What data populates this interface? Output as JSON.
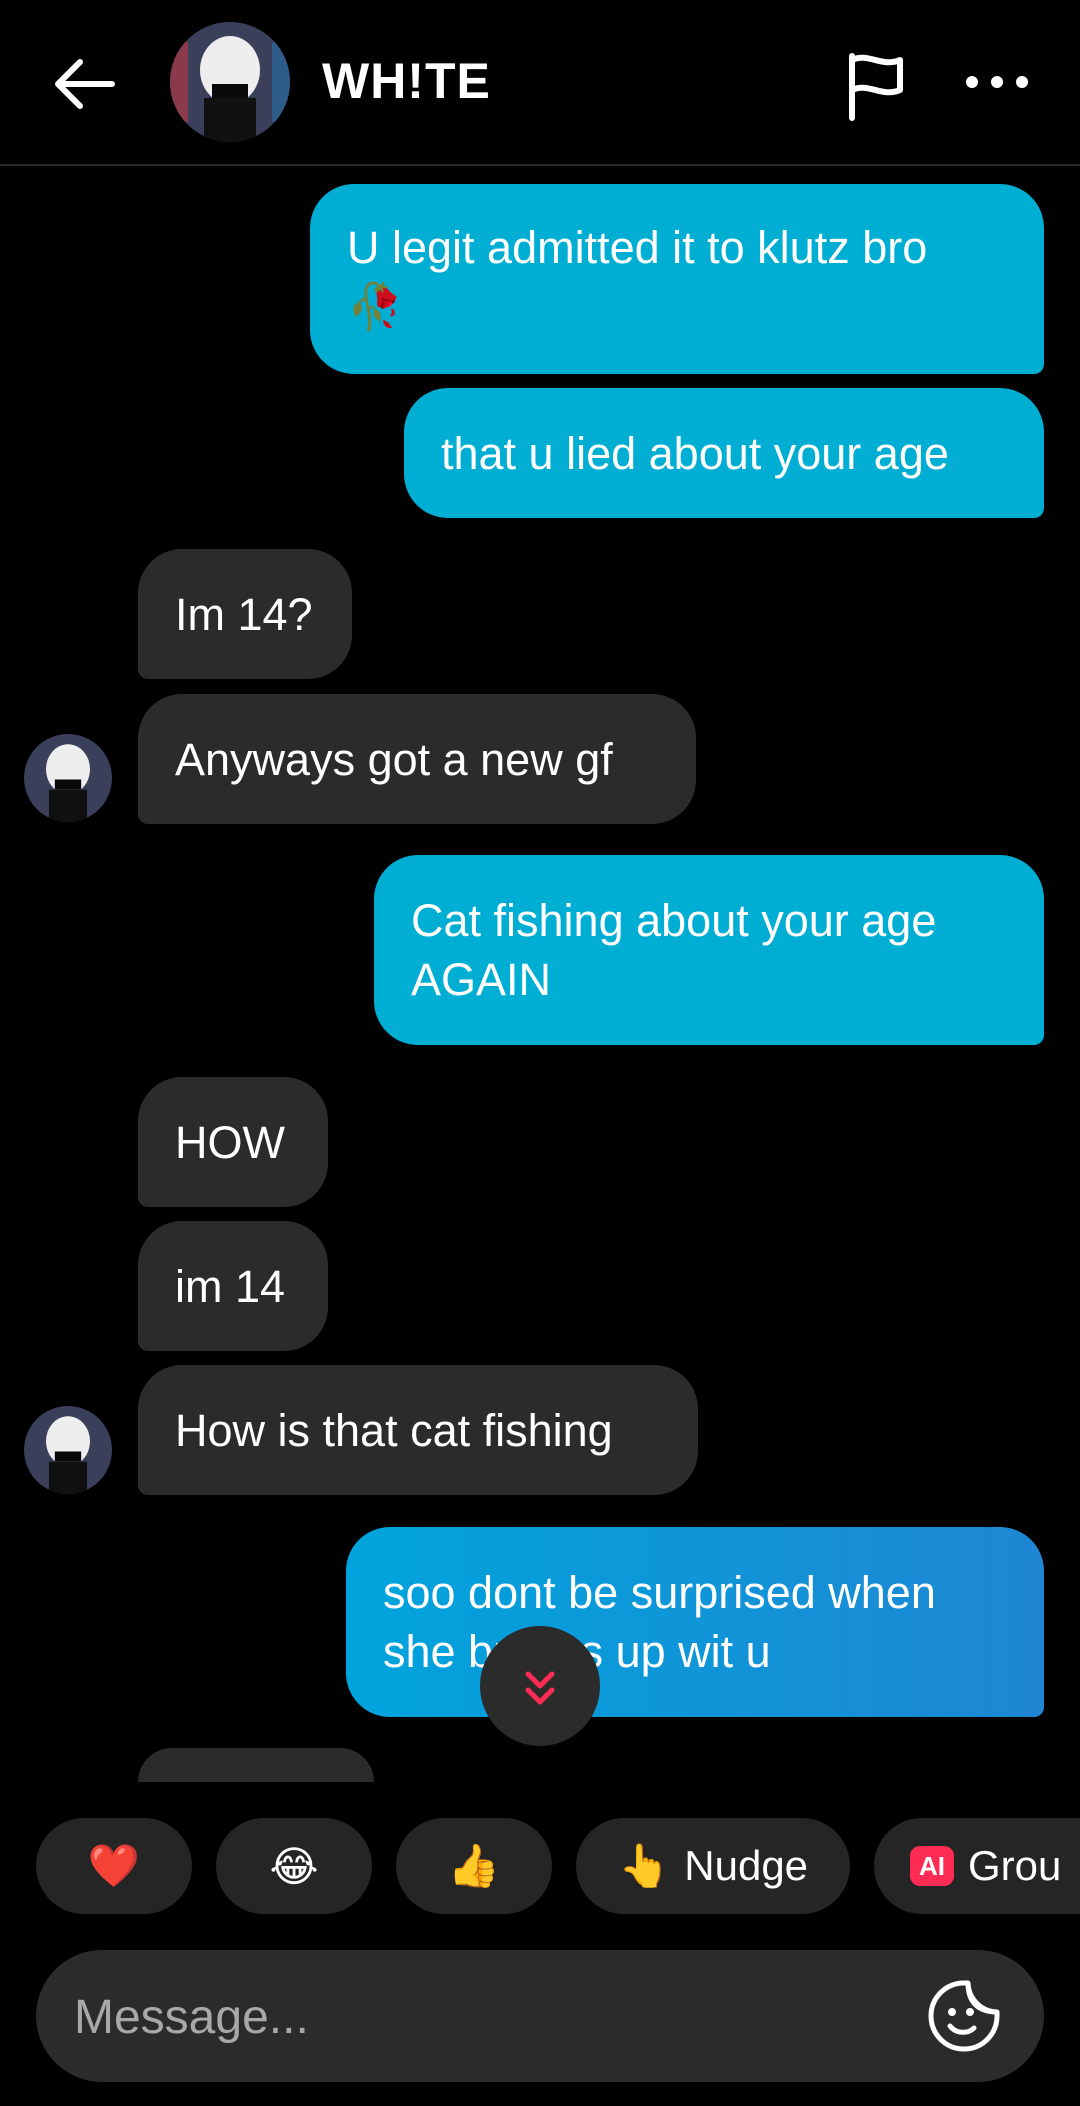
{
  "header": {
    "title": "WH!TE",
    "icons": [
      "back-arrow-icon",
      "flag-icon",
      "more-icon"
    ]
  },
  "messages": [
    {
      "side": "out",
      "text_line1": "U legit admitted it to klutz bro",
      "text_line2": "🥀"
    },
    {
      "side": "out",
      "text": "that u lied about your age"
    },
    {
      "side": "in",
      "text": "Im 14?"
    },
    {
      "side": "in",
      "text": "Anyways got a new gf"
    },
    {
      "side": "out",
      "text_line1": "Cat fishing about your age",
      "text_line2": "AGAIN"
    },
    {
      "side": "in",
      "text": "HOW"
    },
    {
      "side": "in",
      "text": "im 14"
    },
    {
      "side": "in",
      "text": "How is that cat fishing"
    },
    {
      "side": "out",
      "text_line1": "soo dont be surprised when",
      "text_line2": "she breaks up wit u"
    }
  ],
  "quick_reactions": [
    {
      "emoji": "❤️",
      "label": ""
    },
    {
      "emoji": "😂",
      "label": ""
    },
    {
      "emoji": "👍",
      "label": ""
    },
    {
      "emoji": "👆",
      "label": "Nudge"
    },
    {
      "badge": "AI",
      "label": "Grou"
    }
  ],
  "composer": {
    "placeholder": "Message..."
  },
  "colors": {
    "outgoing_bubble": "#00aed3",
    "incoming_bubble": "#2b2b2b",
    "accent_red": "#fe2c55",
    "background": "#000000"
  }
}
